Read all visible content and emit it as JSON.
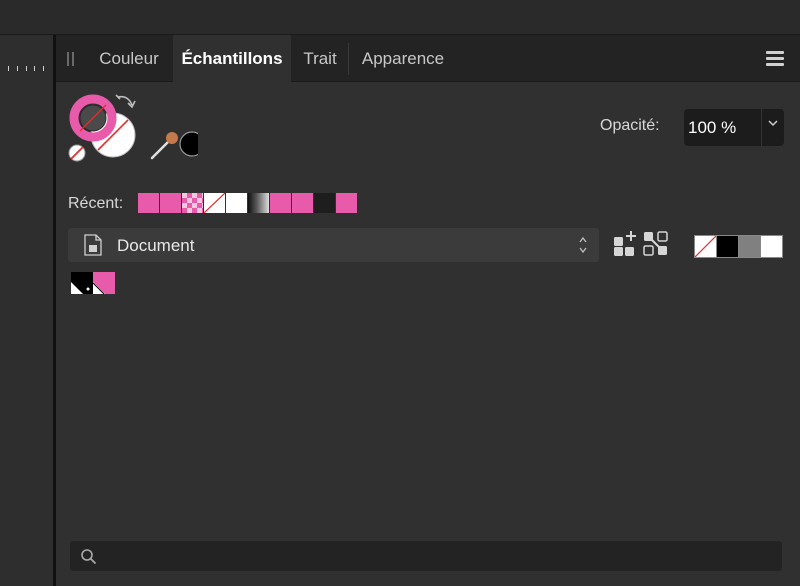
{
  "tabs": [
    {
      "label": "Couleur",
      "active": false
    },
    {
      "label": "Échantillons",
      "active": true
    },
    {
      "label": "Trait",
      "active": false
    },
    {
      "label": "Apparence",
      "active": false
    }
  ],
  "opacity": {
    "label": "Opacité:",
    "value": "100 %"
  },
  "recent": {
    "label": "Récent:",
    "swatches": [
      "#e85aaa",
      "#e85aaa",
      "checker-pink",
      "none",
      "#ffffff",
      "gradient-gray",
      "#e85aaa",
      "#e85aaa",
      "#1e1e1e",
      "#e85aaa"
    ]
  },
  "palette": {
    "selected": "Document"
  },
  "quick_swatches": [
    "none",
    "#000000",
    "#808080",
    "#ffffff"
  ],
  "document_swatches": [
    "#000000",
    "#e85aaa"
  ],
  "search": {
    "placeholder": ""
  },
  "colors": {
    "accent_pink": "#e85aaa",
    "panel_bg": "#303030",
    "tab_bar_bg": "#232323"
  }
}
